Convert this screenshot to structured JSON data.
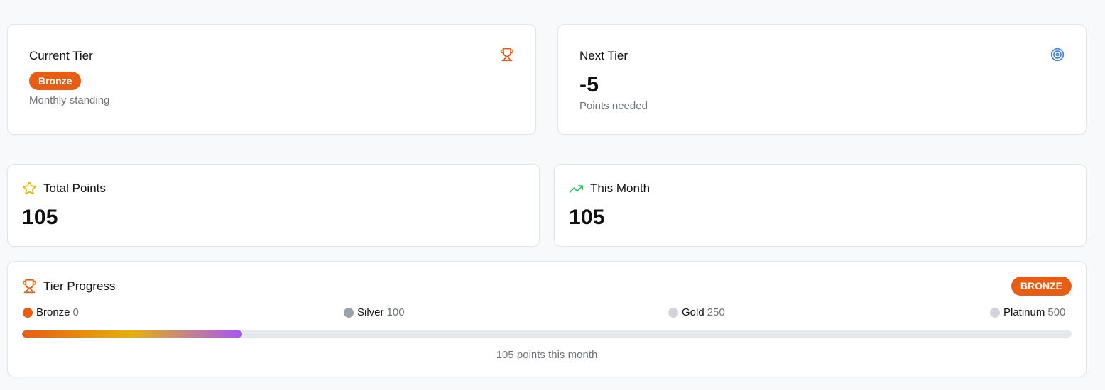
{
  "current_tier": {
    "title": "Current Tier",
    "badge": "Bronze",
    "caption": "Monthly standing",
    "icon": "trophy-icon"
  },
  "next_tier": {
    "title": "Next Tier",
    "value": "-5",
    "caption": "Points needed",
    "icon": "target-icon"
  },
  "total_points": {
    "title": "Total Points",
    "value": "105",
    "icon": "star-icon"
  },
  "this_month": {
    "title": "This Month",
    "value": "105",
    "icon": "trending-up-icon"
  },
  "tier_progress": {
    "title": "Tier Progress",
    "badge": "BRONZE",
    "icon": "trophy-icon",
    "tiers": [
      {
        "name": "Bronze",
        "points": "0",
        "color": "#e85d14"
      },
      {
        "name": "Silver",
        "points": "100",
        "color": "#9ca3af"
      },
      {
        "name": "Gold",
        "points": "250",
        "color": "#d1d5db"
      },
      {
        "name": "Platinum",
        "points": "500",
        "color": "#d1d5db"
      }
    ],
    "progress_fraction": 0.21,
    "caption": "105 points this month"
  },
  "colors": {
    "accent": "#e85d14",
    "target_blue": "#3b82f6",
    "star_yellow": "#eab308",
    "trend_green": "#22c55e",
    "progress_track": "#e5e7eb"
  }
}
